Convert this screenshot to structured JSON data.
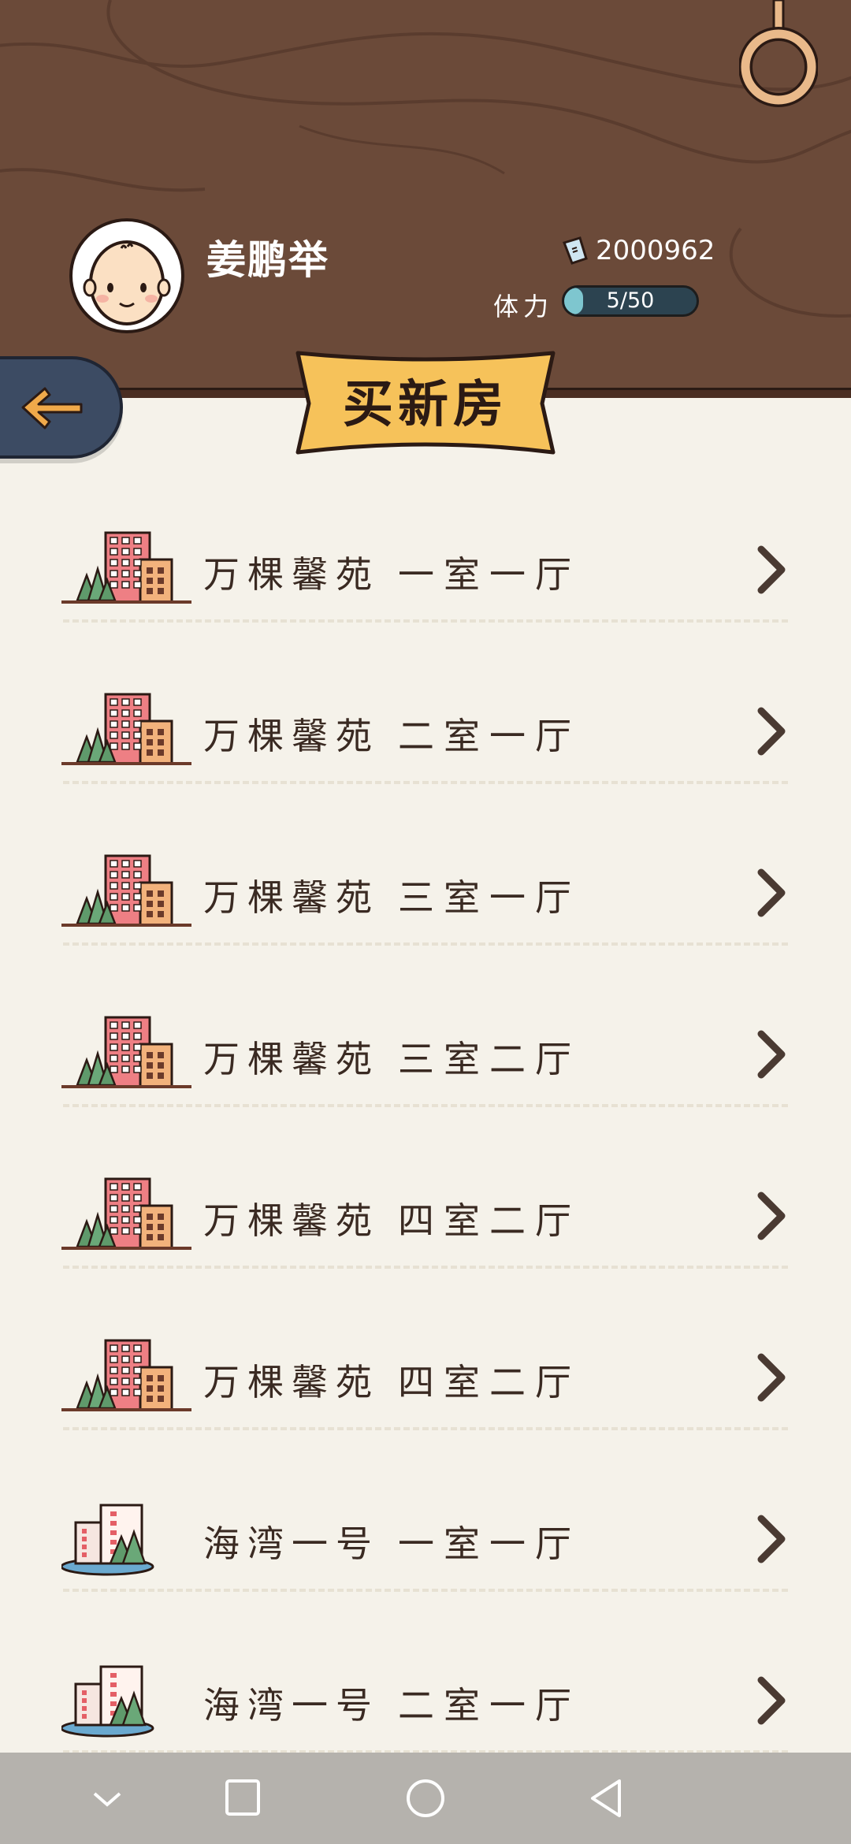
{
  "header": {
    "username": "姜鹏举",
    "coins": "2000962",
    "stamina_label": "体力",
    "stamina_value": "5/50",
    "stamina_fraction": 0.1,
    "title": "买新房"
  },
  "listings": [
    {
      "name": "万棵馨苑",
      "layout": "一室一厅",
      "icon": "apartment-tower-icon"
    },
    {
      "name": "万棵馨苑",
      "layout": "二室一厅",
      "icon": "apartment-tower-icon"
    },
    {
      "name": "万棵馨苑",
      "layout": "三室一厅",
      "icon": "apartment-tower-icon"
    },
    {
      "name": "万棵馨苑",
      "layout": "三室二厅",
      "icon": "apartment-tower-icon"
    },
    {
      "name": "万棵馨苑",
      "layout": "四室二厅",
      "icon": "apartment-tower-icon"
    },
    {
      "name": "万棵馨苑",
      "layout": "四室二厅",
      "icon": "apartment-tower-icon"
    },
    {
      "name": "海湾一号",
      "layout": "一室一厅",
      "icon": "seaside-building-icon"
    },
    {
      "name": "海湾一号",
      "layout": "二室一厅",
      "icon": "seaside-building-icon"
    }
  ],
  "colors": {
    "wood": "#6b4a39",
    "banner": "#f6c25a",
    "back_button": "#3c4b63",
    "arrow": "#f0a94a",
    "background": "#f5f2ea"
  }
}
